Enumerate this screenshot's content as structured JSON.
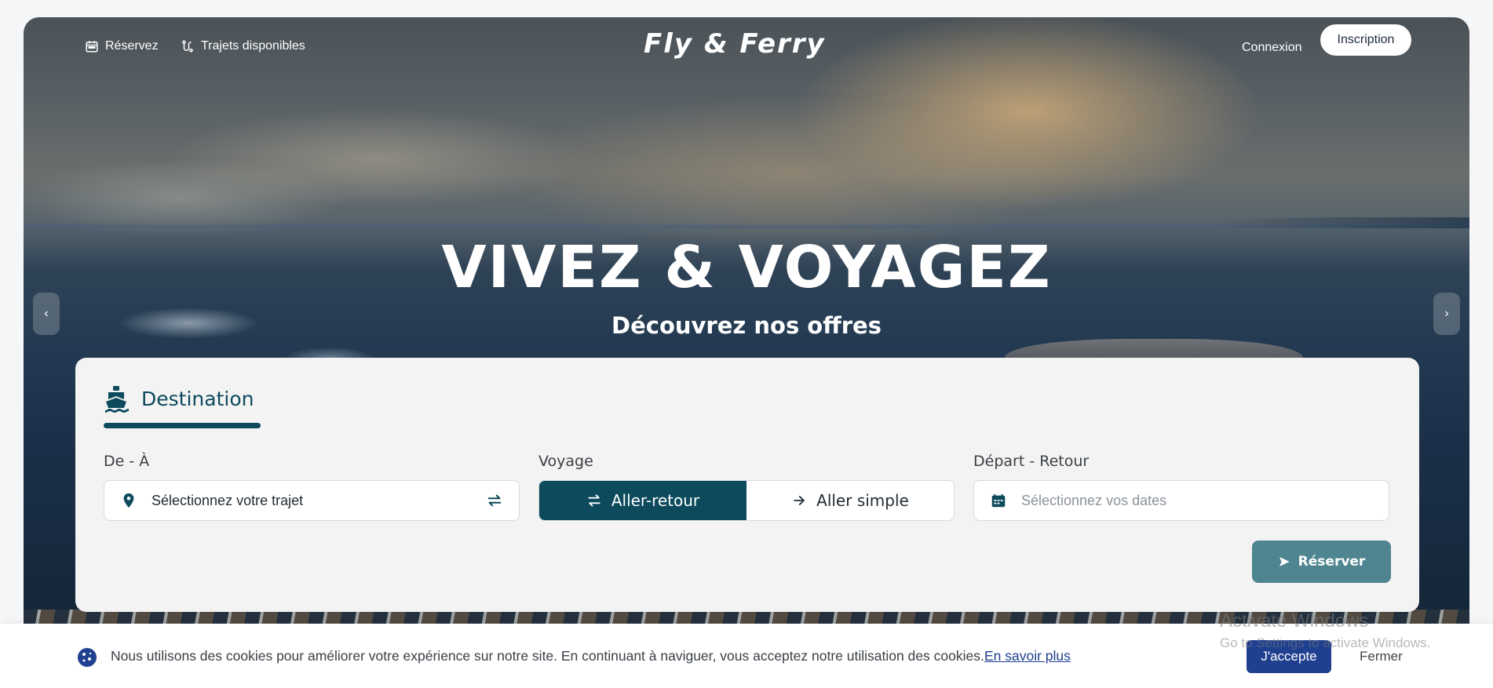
{
  "nav": {
    "reserve_label": "Réservez",
    "trips_label": "Trajets disponibles",
    "logo_text": "Fly & Ferry",
    "login_label": "Connexion",
    "signup_label": "Inscription"
  },
  "hero": {
    "title": "VIVEZ & VOYAGEZ",
    "subtitle": "Découvrez nos offres",
    "prev_glyph": "‹",
    "next_glyph": "›"
  },
  "booking": {
    "tab_label": "Destination",
    "route": {
      "label": "De - À",
      "value": "Sélectionnez votre trajet"
    },
    "trip_type": {
      "label": "Voyage",
      "options": [
        {
          "label": "Aller-retour",
          "selected": true
        },
        {
          "label": "Aller simple",
          "selected": false
        }
      ]
    },
    "dates": {
      "label": "Départ - Retour",
      "placeholder": "Sélectionnez vos dates"
    },
    "submit_label": "Réserver",
    "accent_color": "#0c4a5c",
    "button_color": "#4f8590"
  },
  "cookie_banner": {
    "message": "Nous utilisons des cookies pour améliorer votre expérience sur notre site. En continuant à naviguer, vous acceptez notre utilisation des cookies.",
    "learn_more": "En savoir plus",
    "accept_label": "J'accepte",
    "close_label": "Fermer",
    "accept_color": "#1f3f8f"
  },
  "os_watermark": {
    "line1": "Activate Windows",
    "line2": "Go to Settings to activate Windows."
  }
}
